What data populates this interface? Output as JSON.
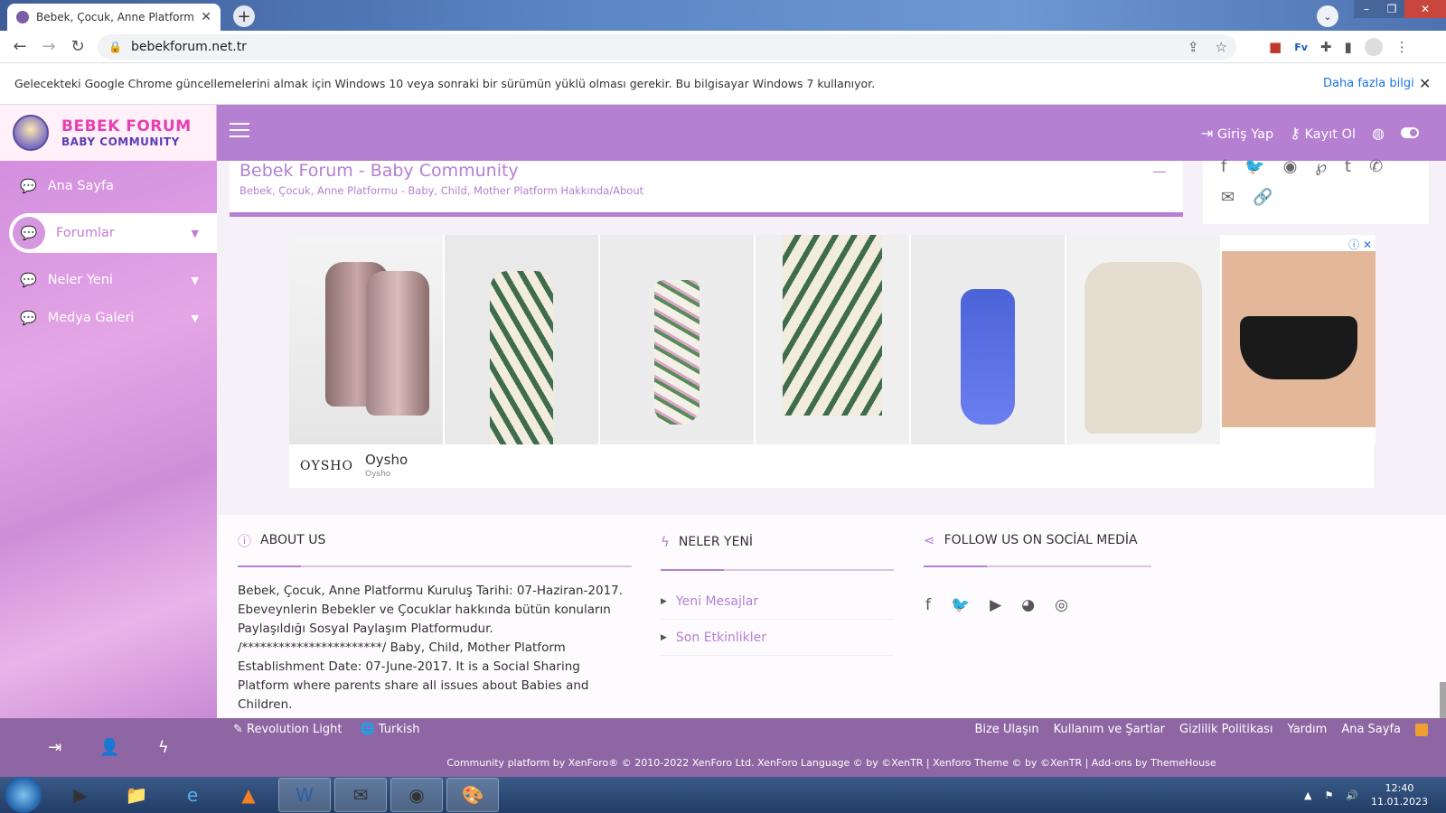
{
  "browser": {
    "tab_title": "Bebek, Çocuk, Anne Platformu - B",
    "url": "bebekforum.net.tr"
  },
  "infobar": {
    "message": "Gelecekteki Google Chrome güncellemelerini almak için Windows 10 veya sonraki bir sürümün yüklü olması gerekir. Bu bilgisayar Windows 7 kullanıyor.",
    "more_link": "Daha fazla bilgi"
  },
  "header": {
    "logo_line1": "BEBEK FORUM",
    "logo_line2": "BABY COMMUNITY",
    "login": "Giriş Yap",
    "register": "Kayıt Ol"
  },
  "sidebar": {
    "items": [
      {
        "label": "Ana Sayfa"
      },
      {
        "label": "Forumlar"
      },
      {
        "label": "Neler Yeni"
      },
      {
        "label": "Medya Galeri"
      }
    ]
  },
  "main": {
    "title": "Bebek Forum - Baby Community",
    "subtitle": "Bebek, Çocuk, Anne Platformu - Baby, Child, Mother Platform Hakkında/About"
  },
  "ad": {
    "brand": "OYSHO",
    "name": "Oysho",
    "sub": "Oysho"
  },
  "footer_info": {
    "about_title": "ABOUT US",
    "about_text": "Bebek, Çocuk, Anne Platformu Kuruluş Tarihi: 07-Haziran-2017. Ebeveynlerin Bebekler ve Çocuklar hakkında bütün konuların Paylaşıldığı Sosyal Paylaşım Platformudur. /***********************/ Baby, Child, Mother Platform Establishment Date: 07-June-2017. It is a Social Sharing Platform where parents share all issues about Babies and Children.",
    "new_title": "NELER YENİ",
    "new_links": [
      "Yeni Mesajlar",
      "Son Etkinlikler"
    ],
    "follow_title": "FOLLOW US ON SOCİAL MEDİA"
  },
  "bottom": {
    "style": "Revolution Light",
    "language": "Turkish",
    "links": [
      "Bize Ulaşın",
      "Kullanım ve Şartlar",
      "Gizlilik Politikası",
      "Yardım",
      "Ana Sayfa"
    ],
    "copyright": "Community platform by XenForo® © 2010-2022 XenForo Ltd. XenForo Language © by ©XenTR | Xenforo Theme © by ©XenTR | Add-ons by ThemeHouse"
  },
  "taskbar": {
    "time": "12:40",
    "date": "11.01.2023"
  },
  "colors": {
    "accent": "#b57fd2",
    "footer": "#8e66a3"
  }
}
